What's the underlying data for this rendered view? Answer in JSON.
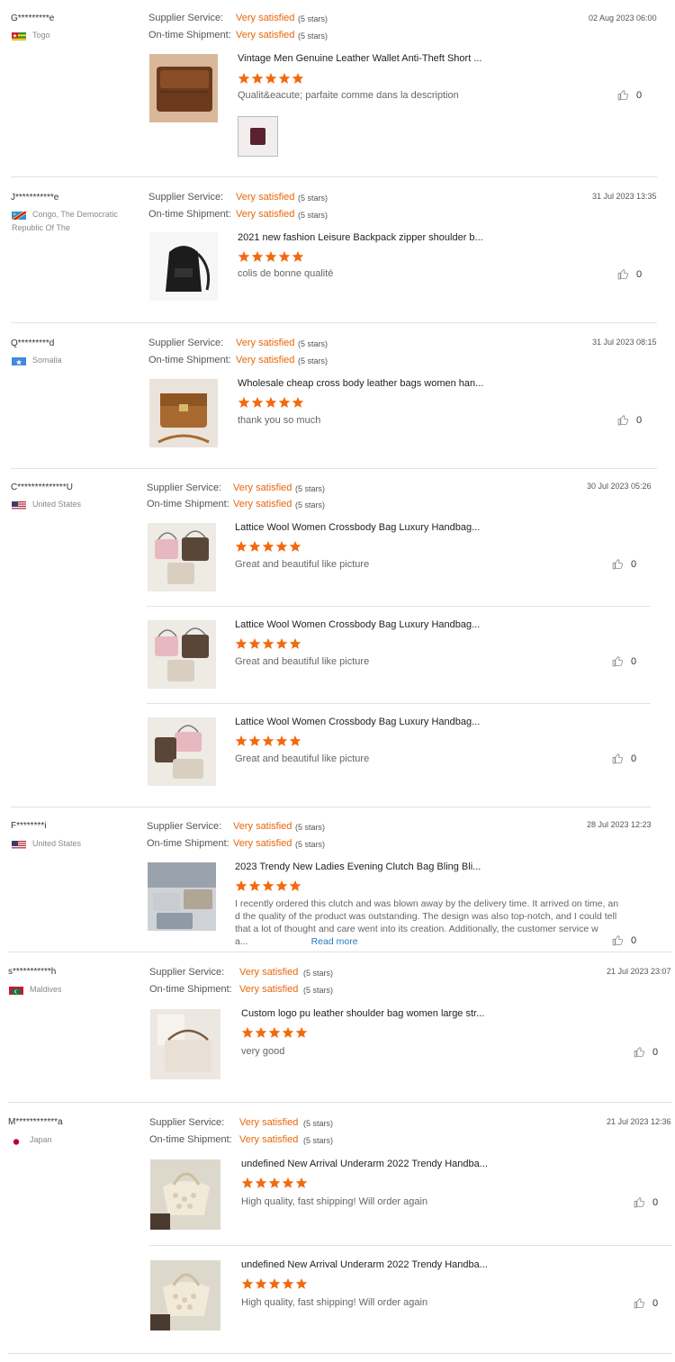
{
  "labels": {
    "supplier_service": "Supplier Service:",
    "ontime_shipment": "On-time Shipment:",
    "read_more": "Read more"
  },
  "reviews": [
    {
      "user": "G*********e",
      "country": "Togo",
      "date": "02 Aug 2023 06:00",
      "supplier_value": "Very satisfied",
      "supplier_stars": "(5 stars)",
      "shipment_value": "Very satisfied",
      "shipment_stars": "(5 stars)",
      "items": [
        {
          "title": "Vintage Men Genuine Leather Wallet Anti-Theft Short ...",
          "rating": 5,
          "comment": "Qualit&eacute; parfaite comme dans la description",
          "likes": "0"
        }
      ]
    },
    {
      "user": "J***********e",
      "country": "Congo, The Democratic Republic Of The",
      "date": "31 Jul 2023 13:35",
      "supplier_value": "Very satisfied",
      "supplier_stars": "(5 stars)",
      "shipment_value": "Very satisfied",
      "shipment_stars": "(5 stars)",
      "items": [
        {
          "title": "2021 new fashion Leisure Backpack zipper shoulder b...",
          "rating": 5,
          "comment": "colis de bonne qualité",
          "likes": "0"
        }
      ]
    },
    {
      "user": "Q*********d",
      "country": "Somalia",
      "date": "31 Jul 2023 08:15",
      "supplier_value": "Very satisfied",
      "supplier_stars": "(5 stars)",
      "shipment_value": "Very satisfied",
      "shipment_stars": "(5 stars)",
      "items": [
        {
          "title": "Wholesale cheap cross body leather bags women han...",
          "rating": 5,
          "comment": "thank you so much",
          "likes": "0"
        }
      ]
    },
    {
      "user": "C**************U",
      "country": "United States",
      "date": "30 Jul 2023 05:26",
      "supplier_value": "Very satisfied",
      "supplier_stars": "(5 stars)",
      "shipment_value": "Very satisfied",
      "shipment_stars": "(5 stars)",
      "items": [
        {
          "title": "Lattice Wool Women Crossbody Bag Luxury Handbag...",
          "rating": 5,
          "comment": "Great and beautiful like picture",
          "likes": "0"
        },
        {
          "title": "Lattice Wool Women Crossbody Bag Luxury Handbag...",
          "rating": 5,
          "comment": "Great and beautiful like picture",
          "likes": "0"
        },
        {
          "title": "Lattice Wool Women Crossbody Bag Luxury Handbag...",
          "rating": 5,
          "comment": "Great and beautiful like picture",
          "likes": "0"
        }
      ]
    },
    {
      "user": "F********i",
      "country": "United States",
      "date": "28 Jul 2023 12:23",
      "supplier_value": "Very satisfied",
      "supplier_stars": "(5 stars)",
      "shipment_value": "Very satisfied",
      "shipment_stars": "(5 stars)",
      "items": [
        {
          "title": "2023 Trendy New Ladies Evening Clutch Bag Bling Bli...",
          "rating": 5,
          "comment_lines": [
            "I recently ordered this clutch and was blown away by the delivery time. It arrived on time, an",
            "d the quality of the product was outstanding. The design was also top-notch, and I could tell",
            "that a lot of thought and care went into its creation. Additionally, the customer service w",
            "a..."
          ],
          "likes": "0"
        }
      ]
    },
    {
      "user": "s***********h",
      "country": "Maldives",
      "date": "21 Jul 2023 23:07",
      "supplier_value": "Very satisfied",
      "supplier_stars": "(5 stars)",
      "shipment_value": "Very satisfied",
      "shipment_stars": "(5 stars)",
      "items": [
        {
          "title": "Custom logo pu leather shoulder bag women large str...",
          "rating": 5,
          "comment": "very good",
          "likes": "0"
        }
      ]
    },
    {
      "user": "M************a",
      "country": "Japan",
      "date": "21 Jul 2023 12:36",
      "supplier_value": "Very satisfied",
      "supplier_stars": "(5 stars)",
      "shipment_value": "Very satisfied",
      "shipment_stars": "(5 stars)",
      "items": [
        {
          "title": "undefined New Arrival Underarm 2022 Trendy Handba...",
          "rating": 5,
          "comment": "High quality, fast shipping! Will order again",
          "likes": "0"
        },
        {
          "title": "undefined New Arrival Underarm 2022 Trendy Handba...",
          "rating": 5,
          "comment": "High quality, fast shipping! Will order again",
          "likes": "0"
        }
      ]
    }
  ],
  "colors": {
    "accent": "#e8660a",
    "star": "#f26a10",
    "link": "#1f7ac4",
    "divider": "#e2e2e2"
  }
}
